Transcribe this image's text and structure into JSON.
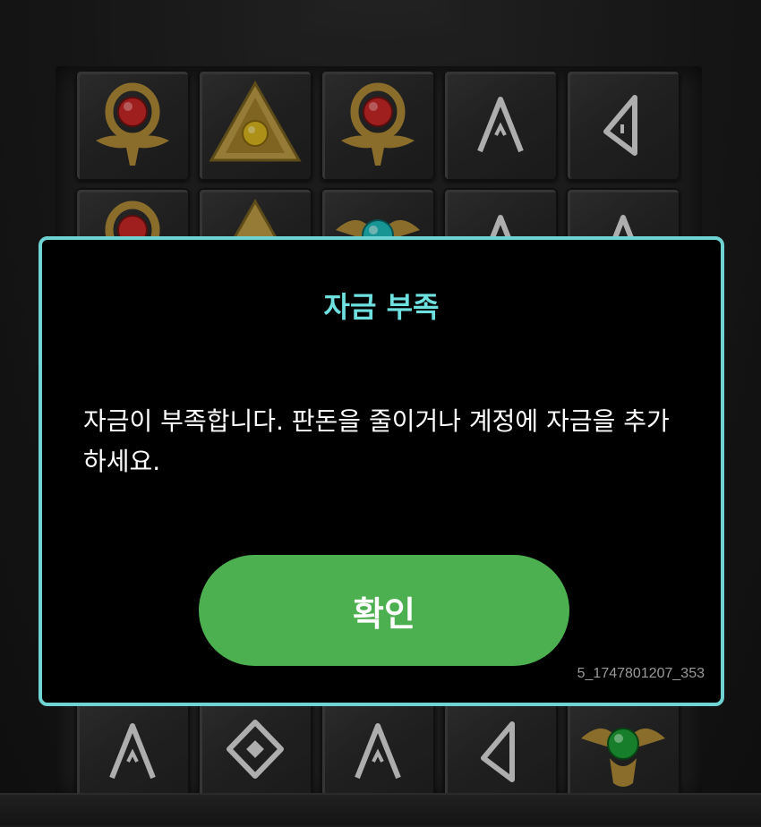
{
  "game": {
    "symbols_visible": [
      "ankh-red-gem",
      "eye-pyramid-yellow-gem",
      "ankh-red-gem",
      "rune-a",
      "rune-triangle",
      "ankh-red-gem",
      "eye-pyramid-yellow-gem",
      "scarab-cyan-gem",
      "rune-a",
      "rune-a",
      "rune-a",
      "rune-diamond",
      "rune-a",
      "rune-triangle",
      "scarab-green-gem"
    ]
  },
  "dialog": {
    "title": "자금 부족",
    "message": "자금이 부족합니다. 판돈을 줄이거나 계정에 자금을 추가하세요.",
    "confirm_label": "확인",
    "session_id": "5_1747801207_353"
  },
  "colors": {
    "dialog_border": "#6fd3d3",
    "title": "#6fe0e0",
    "confirm_button": "#4caf50"
  }
}
